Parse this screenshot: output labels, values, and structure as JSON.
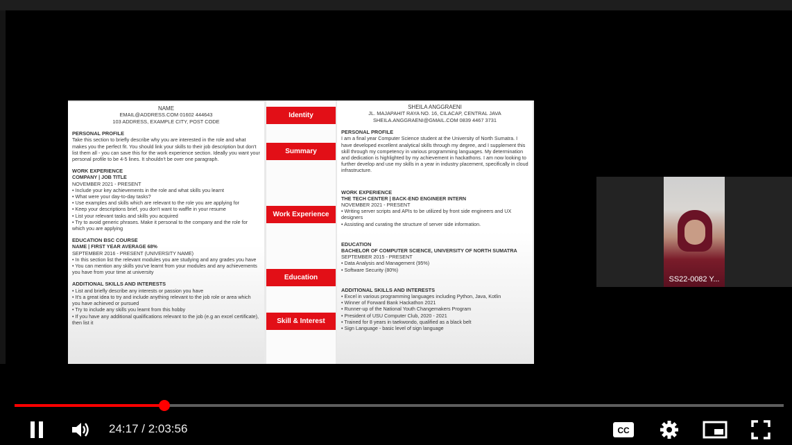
{
  "player": {
    "time_current": "24:17",
    "time_separator": " / ",
    "time_total": "2:03:56",
    "progress_fraction": 0.195,
    "accent_color": "#ff0000"
  },
  "slide": {
    "tabs": [
      "Identity",
      "Summary",
      "Work Experience",
      "Education",
      "Skill & Interest"
    ],
    "left_doc": {
      "header": [
        "NAME",
        "EMAIL@ADDRESS.COM 01602 444643",
        "103 ADDRESS, EXAMPLE CITY, POST CODE"
      ],
      "profile_title": "PERSONAL PROFILE",
      "profile_text": "Take this section to briefly describe why you are interested in the role and what makes you the perfect fit. You should link your skills to their job description but don't list them all - you can save this for the work experience section. Ideally you want your personal profile to be 4-5 lines. It shouldn't be over one paragraph.",
      "work_title": "WORK EXPERIENCE",
      "work_sub": "COMPANY | JOB TITLE",
      "work_date": "NOVEMBER 2021 - PRESENT",
      "work_items": [
        "Include your key achievements in the role and what skills you learnt",
        "What were your day-to-day tasks?",
        "Use examples and skills which are relevant to the role you are applying for",
        "Keep your descriptions brief, you don't want to waffle in your resume",
        "List your relevant tasks and skills you acquired",
        "Try to avoid generic phrases. Make it personal to the company and the role for which you are applying"
      ],
      "edu_title": "EDUCATION BSC COURSE",
      "edu_sub": "NAME | FIRST YEAR AVERAGE 68%",
      "edu_date": "SEPTEMBER 2016 - PRESENT (UNIVERSITY NAME)",
      "edu_items": [
        "In this section list the relevant modules you are studying and any grades you have",
        "You can mention any skills you've learnt from your modules and any achievements you have from your time at university"
      ],
      "skills_title": "ADDITIONAL SKILLS AND INTERESTS",
      "skills_items": [
        "List and briefly describe any interests or passion you have",
        "It's a great idea to try and include anything relevant to the job role or area which you have achieved or pursued",
        "Try to include any skills you learnt from this hobby",
        "If you have any additional qualifications relevant to the job (e.g an excel certificate), then list it"
      ]
    },
    "right_doc": {
      "header": [
        "SHEILA ANGGRAENI",
        "JL. MAJAPAHIT RAYA NO. 16, CILACAP, CENTRAL JAVA",
        "SHEILA.ANGGRAENI@GMAIL.COM 0839 4467 3731"
      ],
      "profile_title": "PERSONAL PROFILE",
      "profile_text": "I am a final year Computer Science student at the University of North Sumatra. I have developed excellent analytical skills through my degree, and I supplement this skill through my competency in various programming languages. My determination and dedication is highlighted by my achievement in hackathons. I am now looking to further develop and use my skills in a year in industry placement, specifically in cloud infrastructure.",
      "work_title": "WORK EXPERIENCE",
      "work_sub": "THE TECH CENTER | BACK-END ENGINEER INTERN",
      "work_date": "NOVEMBER 2021 - PRESENT",
      "work_items": [
        "Writing server scripts and APIs to be utilized by front side engineers and UX designers",
        "Assisting and curating the structure of server side information."
      ],
      "edu_title": "EDUCATION",
      "edu_sub": "BACHELOR OF COMPUTER SCIENCE, UNIVERSITY OF NORTH SUMATRA",
      "edu_date": "SEPTEMBER 2015 - PRESENT",
      "edu_items": [
        "Data Analysis and Management (95%)",
        "Software Security (80%)"
      ],
      "skills_title": "ADDITIONAL SKILLS AND INTERESTS",
      "skills_items": [
        "Excel in various programming languages including Python, Java, Kotlin",
        "Winner of Forward Bank Hackathon 2021",
        "Runner-up of the National Youth Changemakers Program",
        "President of USU Computer Club, 2020 - 2021",
        "Trained for 8 years in taekwondo, qualified as a black belt",
        "Sign Language - basic level of sign language"
      ]
    }
  },
  "participant": {
    "label": "SS22-0082 Y..."
  },
  "icons": [
    "pause-icon",
    "volume-icon",
    "captions-icon",
    "settings-icon",
    "miniplayer-icon",
    "fullscreen-icon"
  ]
}
